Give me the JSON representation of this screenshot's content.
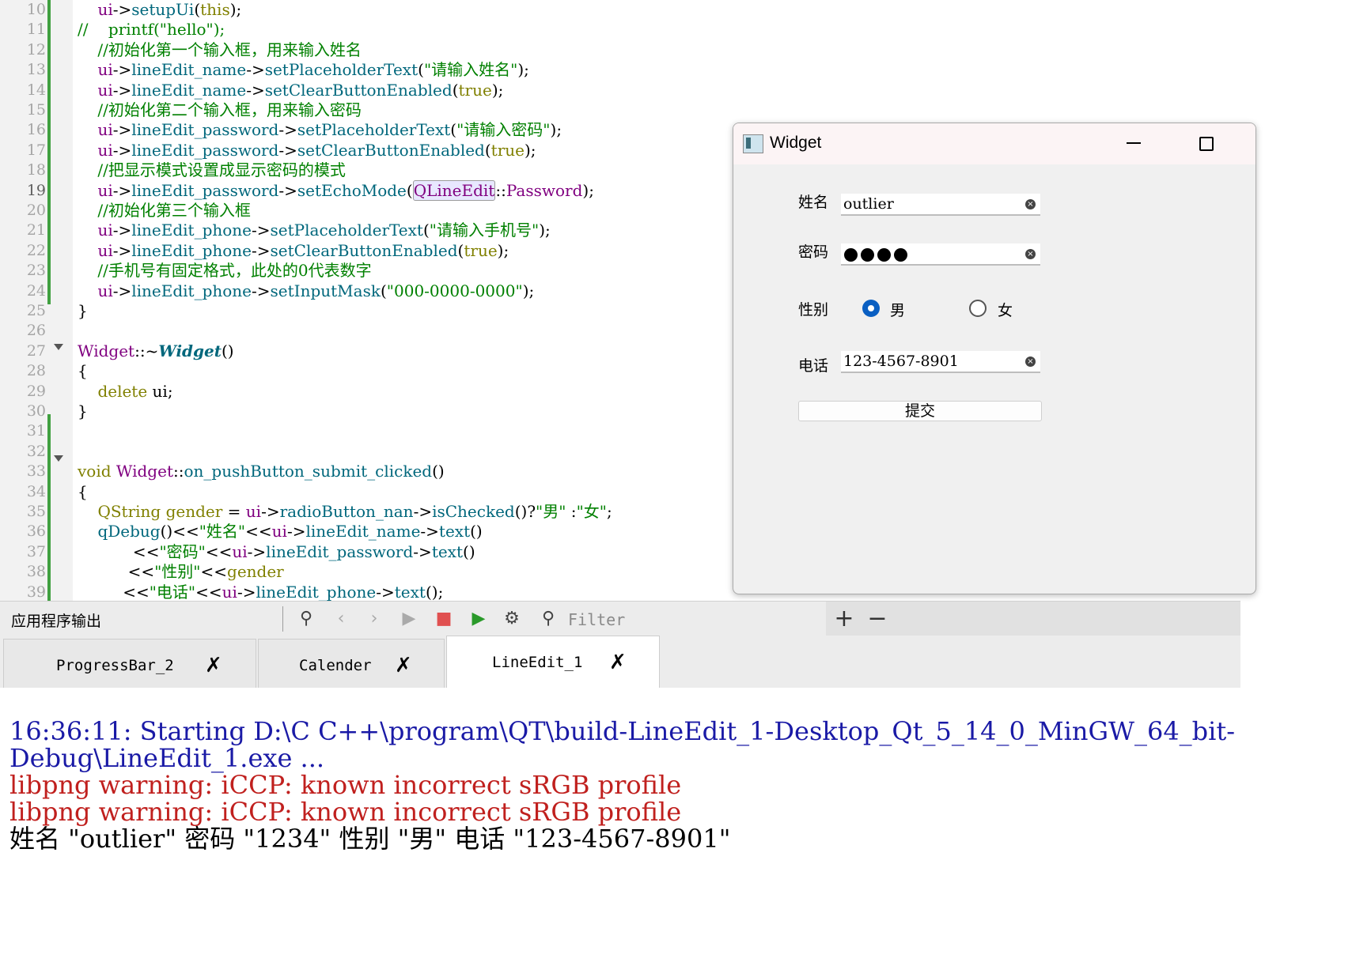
{
  "editor": {
    "line_numbers": [
      "10",
      "11",
      "12",
      "13",
      "14",
      "15",
      "16",
      "17",
      "18",
      "19",
      "20",
      "21",
      "22",
      "23",
      "24",
      "25",
      "26",
      "27",
      "28",
      "29",
      "30",
      "31",
      "32",
      "33",
      "34",
      "35",
      "36",
      "37",
      "38",
      "39"
    ],
    "lines": [
      "    ui->setupUi(this);",
      "//    printf(\"hello\");",
      "    //初始化第一个输入框，用来输入姓名",
      "    ui->lineEdit_name->setPlaceholderText(\"请输入姓名\");",
      "    ui->lineEdit_name->setClearButtonEnabled(true);",
      "    //初始化第二个输入框，用来输入密码",
      "    ui->lineEdit_password->setPlaceholderText(\"请输入密码\");",
      "    ui->lineEdit_password->setClearButtonEnabled(true);",
      "    //把显示模式设置成显示密码的模式",
      "    ui->lineEdit_password->setEchoMode(QLineEdit::Password);",
      "    //初始化第三个输入框",
      "    ui->lineEdit_phone->setPlaceholderText(\"请输入手机号\");",
      "    ui->lineEdit_phone->setClearButtonEnabled(true);",
      "    //手机号有固定格式，此处的0代表数字",
      "    ui->lineEdit_phone->setInputMask(\"000-0000-0000\");",
      "}",
      "",
      "Widget::~Widget()",
      "{",
      "    delete ui;",
      "}",
      "",
      "",
      "void Widget::on_pushButton_submit_clicked()",
      "{",
      "    QString gender = ui->radioButton_nan->isChecked()?\"男\" :\"女\";",
      "    qDebug()<<\"姓名\"<<ui->lineEdit_name->text()",
      "           <<\"密码\"<<ui->lineEdit_password->text()",
      "          <<\"性别\"<<gender",
      "         <<\"电话\"<<ui->lineEdit_phone->text();"
    ]
  },
  "widget": {
    "title": "Widget",
    "name_label": "姓名",
    "name_value": "outlier",
    "password_label": "密码",
    "password_length": 4,
    "gender_label": "性别",
    "gender_male": "男",
    "gender_female": "女",
    "gender_selected": "男",
    "phone_label": "电话",
    "phone_value": "123-4567-8901",
    "submit_label": "提交"
  },
  "output_pane": {
    "title": "应用程序输出",
    "filter_placeholder": "Filter",
    "tabs": [
      {
        "label": "ProgressBar_2",
        "active": false
      },
      {
        "label": "Calender",
        "active": false
      },
      {
        "label": "LineEdit_1",
        "active": true
      }
    ],
    "lines": [
      {
        "text": "16:36:11: Starting D:\\C C++\\program\\QT\\build-LineEdit_1-Desktop_Qt_5_14_0_MinGW_64_bit-",
        "color": "#1a1aa6"
      },
      {
        "text": "Debug\\LineEdit_1.exe ...",
        "color": "#1a1aa6"
      },
      {
        "text": "libpng warning: iCCP: known incorrect sRGB profile",
        "color": "#c0201e"
      },
      {
        "text": "libpng warning: iCCP: known incorrect sRGB profile",
        "color": "#c0201e"
      },
      {
        "text": "姓名 \"outlier\" 密码 \"1234\" 性别 \"男\" 电话 \"123-4567-8901\"",
        "color": "#000000"
      }
    ]
  },
  "colors": {
    "keyword": "#808000",
    "type": "#800080",
    "function": "#00677c",
    "string": "#008000",
    "comment": "#008000",
    "accent": "#0a5fc2"
  }
}
